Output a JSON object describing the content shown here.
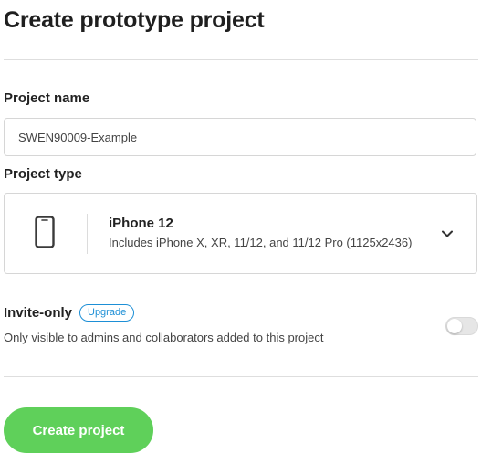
{
  "header": {
    "title": "Create prototype project"
  },
  "form": {
    "project_name": {
      "label": "Project name",
      "value": "SWEN90009-Example"
    },
    "project_type": {
      "label": "Project type",
      "selected_title": "iPhone 12",
      "selected_description": "Includes iPhone X, XR, 11/12, and 11/12 Pro (1125x2436)",
      "icon": "phone-icon"
    },
    "invite_only": {
      "label": "Invite-only",
      "badge": "Upgrade",
      "description": "Only visible to admins and collaborators added to this project",
      "enabled": false
    },
    "submit_label": "Create project"
  },
  "colors": {
    "accent_green": "#5fd05a",
    "badge_blue": "#1d8fd6",
    "border": "#d6d6d6",
    "toggle_off": "#e6e6e6"
  }
}
